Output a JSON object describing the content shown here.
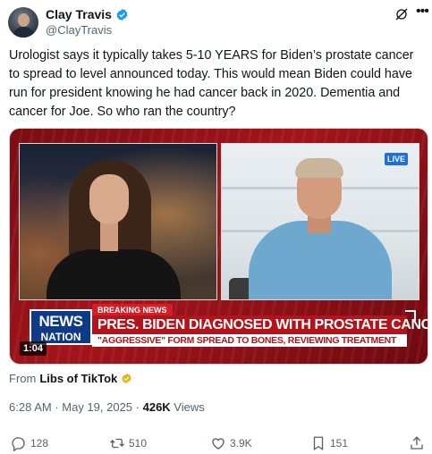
{
  "author": {
    "display_name": "Clay Travis",
    "handle": "@ClayTravis",
    "verified_color": "#1d9bf0"
  },
  "tweet": {
    "text": "Urologist says it typically takes 5-10 YEARS for Biden’s prostate cancer to spread to level announced today. This would mean Biden could have run for president knowing he had cancer back in 2020. Dementia and cancer for Joe. So who ran the country?"
  },
  "video": {
    "live_badge": "LIVE",
    "chyron_label": "BREAKING NEWS",
    "chyron_headline": "PRES. BIDEN DIAGNOSED WITH PROSTATE CANCER",
    "chyron_subline": "\"AGGRESSIVE\" FORM SPREAD TO BONES, REVIEWING TREATMENT",
    "logo_top": "NEWS",
    "logo_bottom": "NATION",
    "duration": "1:04"
  },
  "source": {
    "from_label": "From",
    "name": "Libs of TikTok",
    "badge_color": "#e2b719"
  },
  "meta": {
    "time": "6:28 AM",
    "separator": " · ",
    "date": "May 19, 2025",
    "views_count": "426K",
    "views_label": " Views"
  },
  "actions": {
    "replies": "128",
    "reposts": "510",
    "likes": "3.9K",
    "bookmarks": "151"
  },
  "icons": [
    "grok-icon",
    "more-icon",
    "reply-icon",
    "repost-icon",
    "like-icon",
    "bookmark-icon",
    "share-icon"
  ]
}
